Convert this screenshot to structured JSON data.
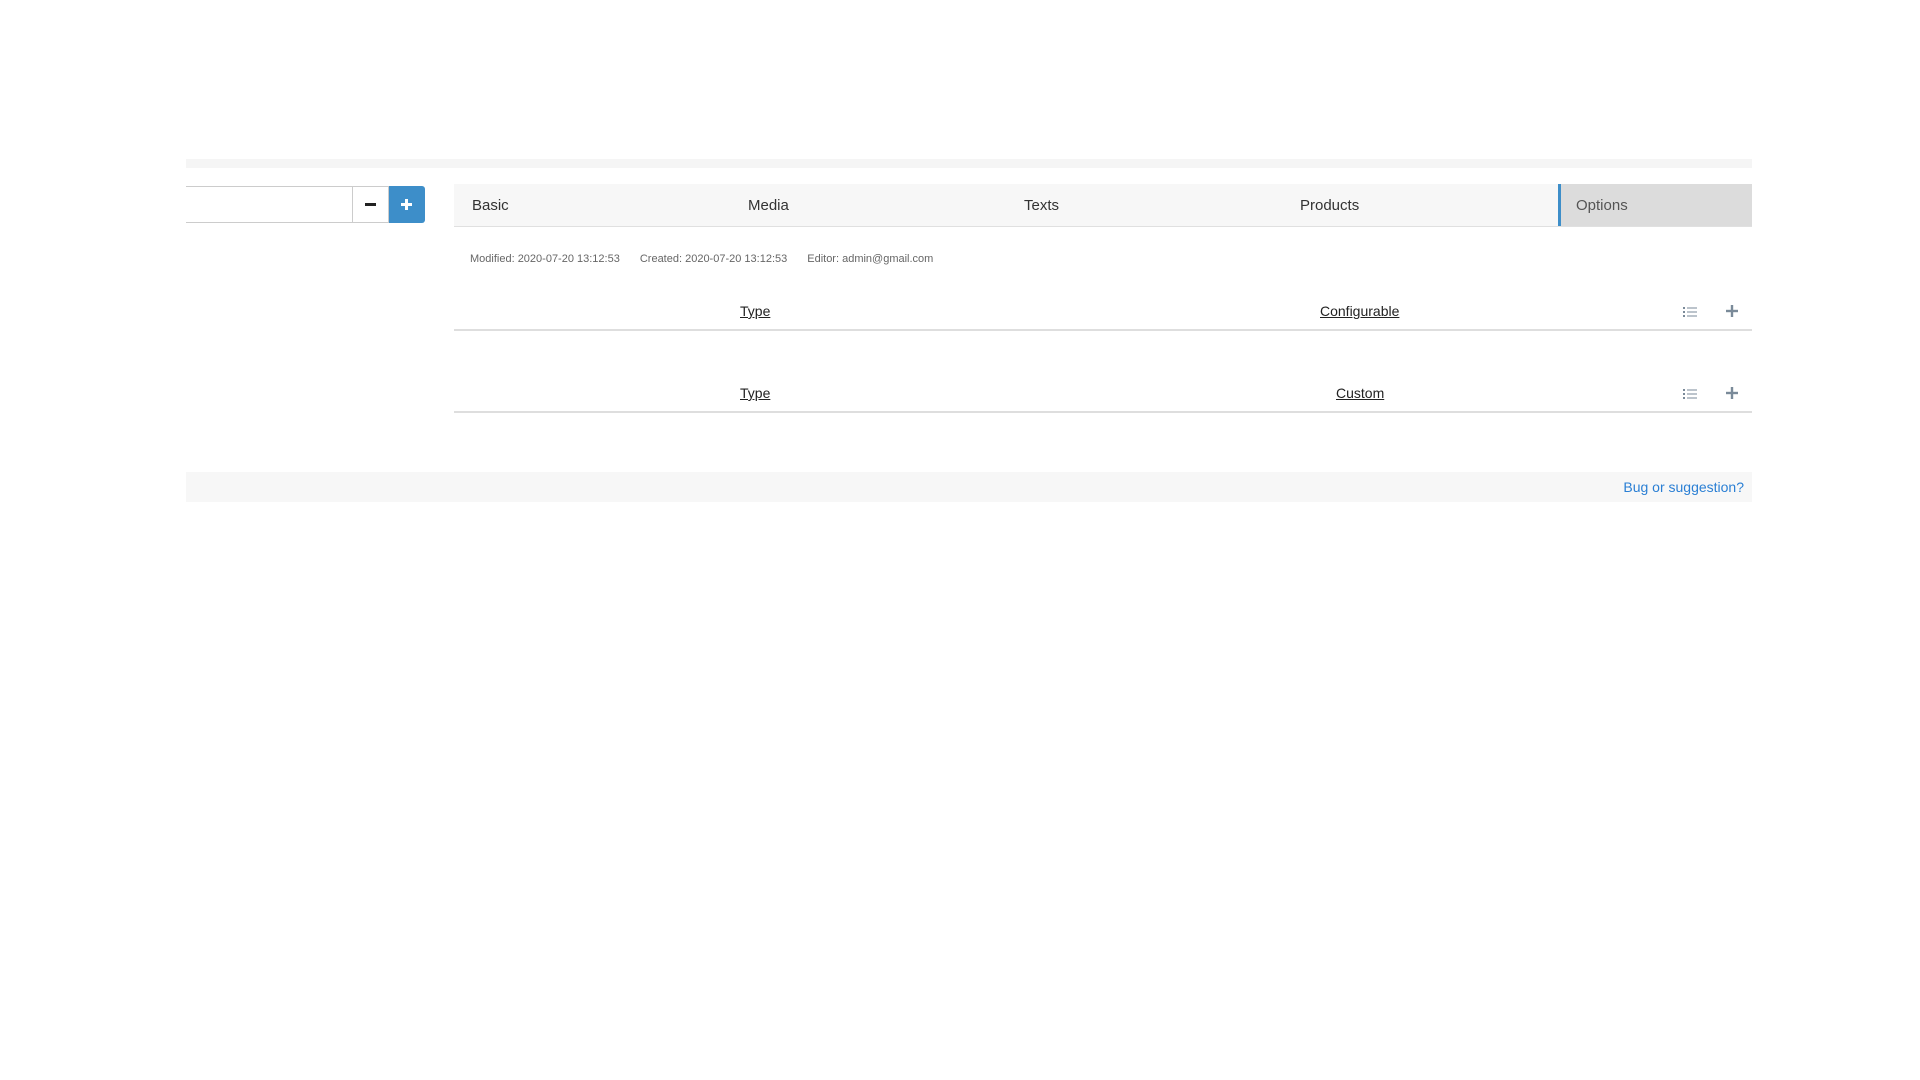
{
  "sidebar": {
    "search_value": "",
    "collapse_label": "−",
    "expand_label": "+"
  },
  "tabs": [
    {
      "label": "Basic"
    },
    {
      "label": "Media"
    },
    {
      "label": "Texts"
    },
    {
      "label": "Products"
    },
    {
      "label": "Options",
      "active": true
    }
  ],
  "meta": {
    "modified": "Modified: 2020-07-20 13:12:53",
    "created": "Created: 2020-07-20 13:12:53",
    "editor": "Editor: admin@gmail.com"
  },
  "options": [
    {
      "type_label": "Type",
      "value": "Configurable",
      "list_icon": "list-icon",
      "add_icon": "plus-icon"
    },
    {
      "type_label": "Type",
      "value": "Custom",
      "list_icon": "list-icon",
      "add_icon": "plus-icon"
    }
  ],
  "footer": {
    "link_label": "Bug or suggestion?"
  },
  "colors": {
    "accent": "#3d8ec9",
    "link": "#2a7fd4"
  }
}
